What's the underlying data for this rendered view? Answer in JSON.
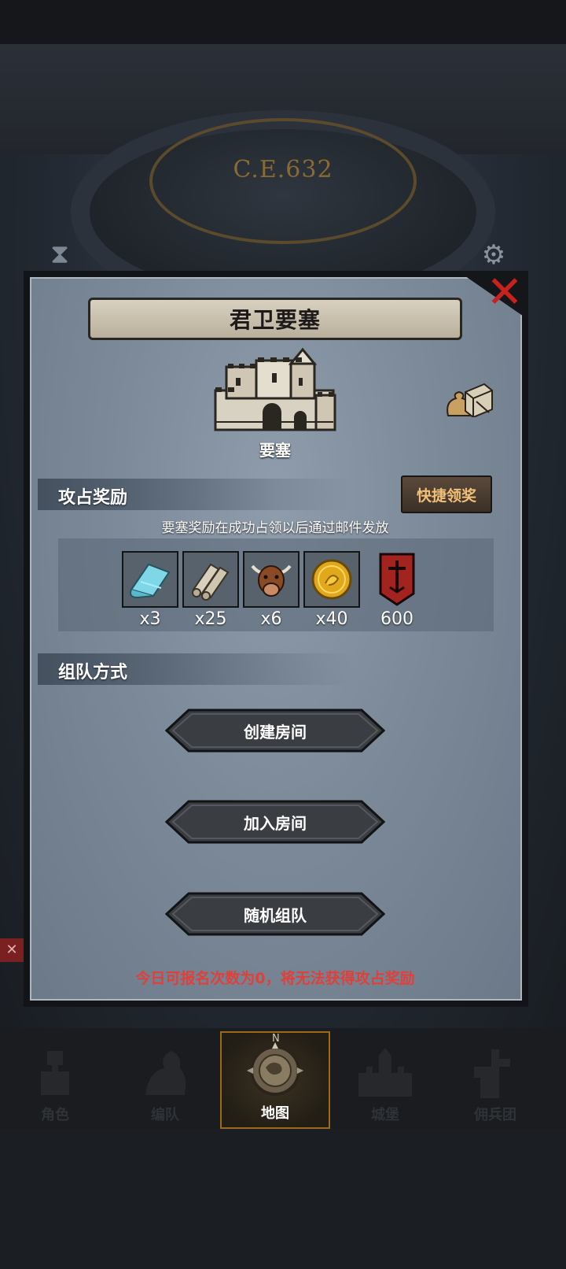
{
  "header": {
    "year": "C.E.632"
  },
  "panel": {
    "title": "君卫要塞",
    "building_label": "要塞",
    "close_icon": "close-icon"
  },
  "rewards_section": {
    "title": "攻占奖励",
    "quick_claim_label": "快捷领奖",
    "notice": "要塞奖励在成功占领以后通过邮件发放",
    "items": [
      {
        "icon": "cloth-icon",
        "count": "x3"
      },
      {
        "icon": "scroll-icon",
        "count": "x25"
      },
      {
        "icon": "cattle-icon",
        "count": "x6"
      },
      {
        "icon": "gold-coin-icon",
        "count": "x40"
      },
      {
        "icon": "guild-banner-icon",
        "count": "600"
      }
    ]
  },
  "team_section": {
    "title": "组队方式",
    "buttons": [
      "创建房间",
      "加入房间",
      "随机组队"
    ],
    "warning": "今日可报名次数为0，将无法获得攻占奖励"
  },
  "nav": {
    "items": [
      {
        "label": "角色",
        "icon": "knight-icon"
      },
      {
        "label": "编队",
        "icon": "horse-icon"
      },
      {
        "label": "地图",
        "icon": "compass-map-icon",
        "compass_mark": "N"
      },
      {
        "label": "城堡",
        "icon": "castle-icon"
      },
      {
        "label": "佣兵团",
        "icon": "mercenary-icon"
      }
    ],
    "active_index": 2
  },
  "colors": {
    "warning": "#e0403a",
    "quick_claim_text": "#f0c078",
    "close": "#c8211e",
    "active_nav_border": "#9a6a1a"
  }
}
